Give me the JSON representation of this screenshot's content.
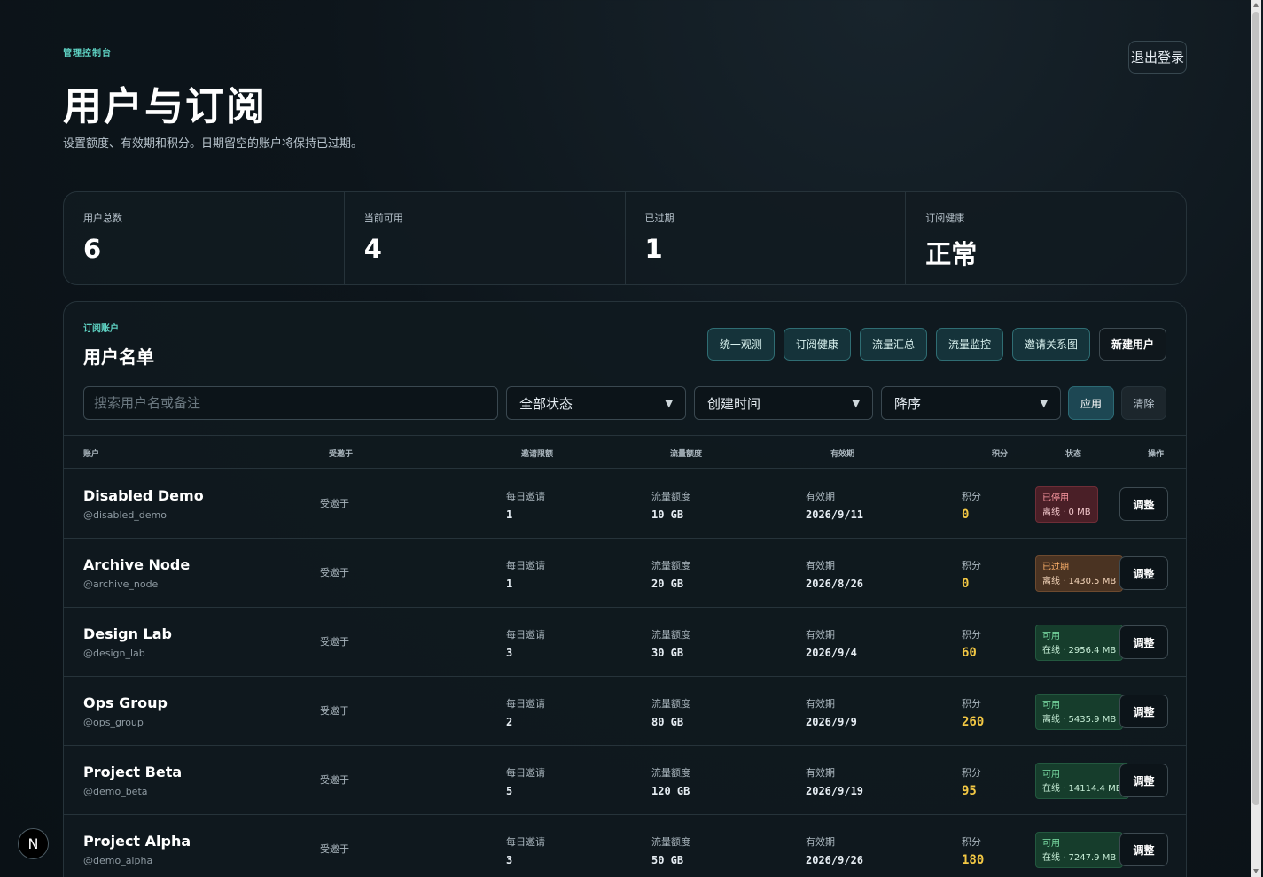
{
  "header": {
    "eyebrow": "管理控制台",
    "title": "用户与订阅",
    "subtitle": "设置额度、有效期和积分。日期留空的账户将保持已过期。",
    "logout_label": "退出登录"
  },
  "stats": [
    {
      "label": "用户总数",
      "value": "6"
    },
    {
      "label": "当前可用",
      "value": "4"
    },
    {
      "label": "已过期",
      "value": "1"
    },
    {
      "label": "订阅健康",
      "value": "正常"
    }
  ],
  "panel": {
    "eyebrow": "订阅账户",
    "title": "用户名单",
    "actions": {
      "overview": "统一观测",
      "health": "订阅健康",
      "traffic_summary": "流量汇总",
      "traffic_monitor": "流量监控",
      "invite_graph": "邀请关系图",
      "new_user": "新建用户"
    }
  },
  "filters": {
    "search_placeholder": "搜索用户名或备注",
    "status_value": "全部状态",
    "sort_field_value": "创建时间",
    "sort_order_value": "降序",
    "apply_label": "应用",
    "clear_label": "清除"
  },
  "table": {
    "headers": {
      "account": "账户",
      "invited_by": "受邀于",
      "invite_limit": "邀请限额",
      "traffic_quota": "流量额度",
      "validity": "有效期",
      "points": "积分",
      "status": "状态",
      "action": "操作"
    },
    "rows": [
      {
        "name": "Disabled Demo",
        "handle": "@disabled_demo",
        "invited": "受邀于",
        "invite_label": "每日邀请",
        "invite_value": "1",
        "quota_label": "流量额度",
        "quota_value": "10 GB",
        "valid_label": "有效期",
        "valid_value": "2026/9/11",
        "points_label": "积分",
        "points_value": "0",
        "status_line1": "已停用",
        "status_line2": "离线 · 0 MB",
        "action_label": "调整"
      },
      {
        "name": "Archive Node",
        "handle": "@archive_node",
        "invited": "受邀于",
        "invite_label": "每日邀请",
        "invite_value": "1",
        "quota_label": "流量额度",
        "quota_value": "20 GB",
        "valid_label": "有效期",
        "valid_value": "2026/8/26",
        "points_label": "积分",
        "points_value": "0",
        "status_line1": "已过期",
        "status_line2": "离线 · 1430.5 MB",
        "action_label": "调整"
      },
      {
        "name": "Design Lab",
        "handle": "@design_lab",
        "invited": "受邀于",
        "invite_label": "每日邀请",
        "invite_value": "3",
        "quota_label": "流量额度",
        "quota_value": "30 GB",
        "valid_label": "有效期",
        "valid_value": "2026/9/4",
        "points_label": "积分",
        "points_value": "60",
        "status_line1": "可用",
        "status_line2": "在线 · 2956.4 MB",
        "action_label": "调整"
      },
      {
        "name": "Ops Group",
        "handle": "@ops_group",
        "invited": "受邀于",
        "invite_label": "每日邀请",
        "invite_value": "2",
        "quota_label": "流量额度",
        "quota_value": "80 GB",
        "valid_label": "有效期",
        "valid_value": "2026/9/9",
        "points_label": "积分",
        "points_value": "260",
        "status_line1": "可用",
        "status_line2": "离线 · 5435.9 MB",
        "action_label": "调整"
      },
      {
        "name": "Project Beta",
        "handle": "@demo_beta",
        "invited": "受邀于",
        "invite_label": "每日邀请",
        "invite_value": "5",
        "quota_label": "流量额度",
        "quota_value": "120 GB",
        "valid_label": "有效期",
        "valid_value": "2026/9/19",
        "points_label": "积分",
        "points_value": "95",
        "status_line1": "可用",
        "status_line2": "在线 · 14114.4 MB",
        "action_label": "调整"
      },
      {
        "name": "Project Alpha",
        "handle": "@demo_alpha",
        "invited": "受邀于",
        "invite_label": "每日邀请",
        "invite_value": "3",
        "quota_label": "流量额度",
        "quota_value": "50 GB",
        "valid_label": "有效期",
        "valid_value": "2026/9/26",
        "points_label": "积分",
        "points_value": "180",
        "status_line1": "可用",
        "status_line2": "在线 · 7247.9 MB",
        "action_label": "调整"
      }
    ]
  },
  "badge": {
    "letter": "N"
  },
  "colors": {
    "accent": "#5fd3c4",
    "points": "#f2c744",
    "status_ok": "#7ee3a8",
    "status_disabled": "#ff9aa3",
    "status_expired": "#ffb26b"
  }
}
